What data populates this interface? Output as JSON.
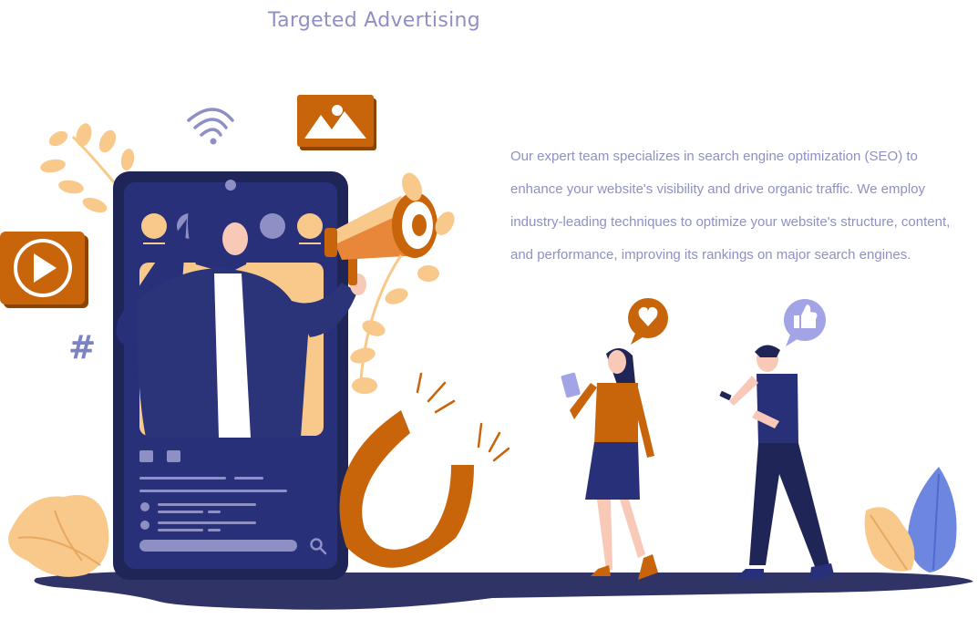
{
  "section": {
    "title": "Targeted Advertising",
    "description": "Our expert team specializes in search engine optimization (SEO) to enhance your website's visibility and drive organic traffic. We employ industry-leading techniques to optimize your website's structure, content, and performance, improving its rankings on major search engines."
  },
  "illustration": {
    "hashtag_symbol": "#",
    "icons": [
      "play-icon",
      "image-icon",
      "wifi-icon",
      "megaphone-icon",
      "magnet-icon",
      "heart-icon",
      "thumbs-up-icon",
      "search-icon"
    ],
    "colors": {
      "navy": "#1f2556",
      "indigo": "#29307a",
      "orange": "#c8640a",
      "peach": "#f9c98b",
      "lavender": "#8e8fc4",
      "blue_plant": "#6d86e0",
      "ground": "#2f3366"
    }
  }
}
